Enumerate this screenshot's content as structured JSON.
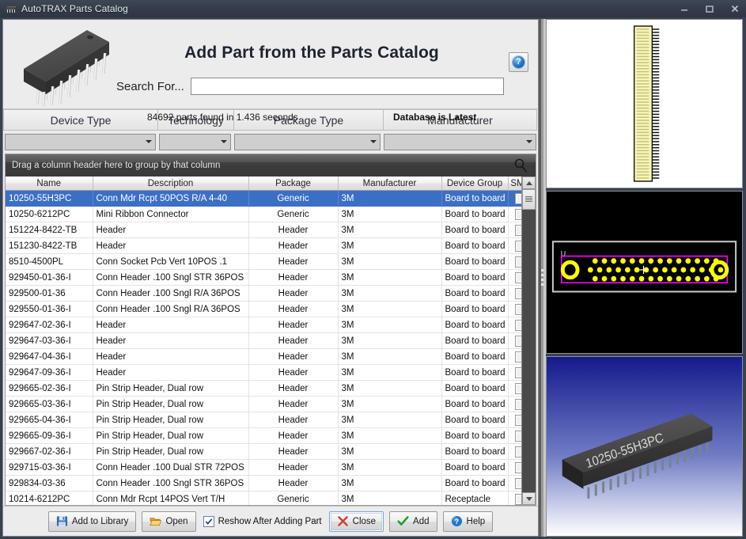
{
  "window": {
    "title": "AutoTRAX Parts Catalog",
    "minimize_label": "Minimize",
    "maximize_label": "Maximize",
    "close_label": "Close"
  },
  "header": {
    "page_title": "Add Part from the Parts Catalog",
    "search_label": "Search For...",
    "search_value": "",
    "search_placeholder": "",
    "results_text": "84692 parts found in 1.436 seconds",
    "database_status": "Database is Latest",
    "help_glyph": "?"
  },
  "filters": {
    "tabs": [
      {
        "label": "Device Type",
        "selected_value": ""
      },
      {
        "label": "Technology",
        "selected_value": ""
      },
      {
        "label": "Package Type",
        "selected_value": ""
      },
      {
        "label": "Manufacturer",
        "selected_value": ""
      }
    ]
  },
  "grid": {
    "group_hint": "Drag a column header here to group by that column",
    "columns": [
      "Name",
      "Description",
      "Package",
      "Manufacturer",
      "Device Group",
      "SMT"
    ],
    "rows": [
      {
        "name": "10250-55H3PC",
        "desc": "Conn Mdr Rcpt 50POS R/A 4-40",
        "pkg": "Generic",
        "mfr": "3M",
        "grp": "Board to board",
        "smt": false,
        "selected": true
      },
      {
        "name": "10250-6212PC",
        "desc": "Mini Ribbon Connector",
        "pkg": "Generic",
        "mfr": "3M",
        "grp": "Board to board",
        "smt": false,
        "selected": false
      },
      {
        "name": "151224-8422-TB",
        "desc": "Header",
        "pkg": "Header",
        "mfr": "3M",
        "grp": "Board to board",
        "smt": false,
        "selected": false
      },
      {
        "name": "151230-8422-TB",
        "desc": "Header",
        "pkg": "Header",
        "mfr": "3M",
        "grp": "Board to board",
        "smt": false,
        "selected": false
      },
      {
        "name": "8510-4500PL",
        "desc": "Conn Socket Pcb Vert 10POS .1",
        "pkg": "Header",
        "mfr": "3M",
        "grp": "Board to board",
        "smt": false,
        "selected": false
      },
      {
        "name": "929450-01-36-I",
        "desc": "Conn Header .100 Sngl STR 36POS",
        "pkg": "Header",
        "mfr": "3M",
        "grp": "Board to board",
        "smt": false,
        "selected": false
      },
      {
        "name": "929500-01-36",
        "desc": "Conn Header .100 Sngl R/A 36POS",
        "pkg": "Header",
        "mfr": "3M",
        "grp": "Board to board",
        "smt": false,
        "selected": false
      },
      {
        "name": "929550-01-36-I",
        "desc": "Conn Header .100 Sngl R/A 36POS",
        "pkg": "Header",
        "mfr": "3M",
        "grp": "Board to board",
        "smt": false,
        "selected": false
      },
      {
        "name": "929647-02-36-I",
        "desc": "Header",
        "pkg": "Header",
        "mfr": "3M",
        "grp": "Board to board",
        "smt": false,
        "selected": false
      },
      {
        "name": "929647-03-36-I",
        "desc": "Header",
        "pkg": "Header",
        "mfr": "3M",
        "grp": "Board to board",
        "smt": false,
        "selected": false
      },
      {
        "name": "929647-04-36-I",
        "desc": "Header",
        "pkg": "Header",
        "mfr": "3M",
        "grp": "Board to board",
        "smt": false,
        "selected": false
      },
      {
        "name": "929647-09-36-I",
        "desc": "Header",
        "pkg": "Header",
        "mfr": "3M",
        "grp": "Board to board",
        "smt": false,
        "selected": false
      },
      {
        "name": "929665-02-36-I",
        "desc": "Pin Strip Header, Dual row",
        "pkg": "Header",
        "mfr": "3M",
        "grp": "Board to board",
        "smt": false,
        "selected": false
      },
      {
        "name": "929665-03-36-I",
        "desc": "Pin Strip Header, Dual row",
        "pkg": "Header",
        "mfr": "3M",
        "grp": "Board to board",
        "smt": false,
        "selected": false
      },
      {
        "name": "929665-04-36-I",
        "desc": "Pin Strip Header, Dual row",
        "pkg": "Header",
        "mfr": "3M",
        "grp": "Board to board",
        "smt": false,
        "selected": false
      },
      {
        "name": "929665-09-36-I",
        "desc": "Pin Strip Header, Dual row",
        "pkg": "Header",
        "mfr": "3M",
        "grp": "Board to board",
        "smt": false,
        "selected": false
      },
      {
        "name": "929667-02-36-I",
        "desc": "Pin Strip Header, Dual row",
        "pkg": "Header",
        "mfr": "3M",
        "grp": "Board to board",
        "smt": false,
        "selected": false
      },
      {
        "name": "929715-03-36-I",
        "desc": "Conn Header .100 Dual STR 72POS",
        "pkg": "Header",
        "mfr": "3M",
        "grp": "Board to board",
        "smt": false,
        "selected": false
      },
      {
        "name": "929834-03-36",
        "desc": "Conn Header .100 Sngl STR 36POS",
        "pkg": "Header",
        "mfr": "3M",
        "grp": "Board to board",
        "smt": false,
        "selected": false
      },
      {
        "name": "10214-6212PC",
        "desc": "Conn Mdr Rcpt 14POS Vert T/H",
        "pkg": "Generic",
        "mfr": "3M",
        "grp": "Receptacle",
        "smt": false,
        "selected": false
      }
    ]
  },
  "toolbar": {
    "add_to_library_label": "Add to Library",
    "open_label": "Open",
    "reshow_label": "Reshow After Adding Part",
    "reshow_checked": true,
    "close_label": "Close",
    "add_label": "Add",
    "help_label": "Help"
  },
  "preview": {
    "symbol_pin_count": 50,
    "pcb_designator": "U",
    "model_label": "10250-55H3PC",
    "colors": {
      "symbol_body": "#f7f6b8",
      "pad": "#ffff00",
      "courtyard": "#ff00ff",
      "silkscreen": "#c8c8c8",
      "pcb_background": "#000000",
      "model_body": "#4a4a4a",
      "sky_top": "#141a8c",
      "sky_bottom": "#ffffff",
      "selection": "#3b6fc4"
    }
  }
}
